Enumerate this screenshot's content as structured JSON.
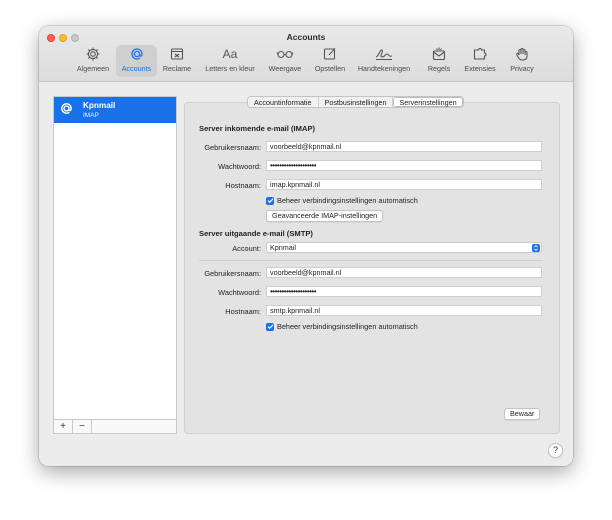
{
  "window": {
    "title": "Accounts"
  },
  "toolbar": {
    "tabs": [
      {
        "label": "Algemeen",
        "icon": "gear-icon"
      },
      {
        "label": "Accounts",
        "icon": "at-icon",
        "active": true
      },
      {
        "label": "Reclame",
        "icon": "junk-mail-icon"
      },
      {
        "label": "Letters en kleur",
        "icon": "font-icon"
      },
      {
        "label": "Weergave",
        "icon": "glasses-icon"
      },
      {
        "label": "Opstellen",
        "icon": "compose-icon"
      },
      {
        "label": "Handtekeningen",
        "icon": "signature-icon"
      },
      {
        "label": "Regels",
        "icon": "rules-icon"
      },
      {
        "label": "Extensies",
        "icon": "extensions-icon"
      },
      {
        "label": "Privacy",
        "icon": "hand-icon"
      }
    ],
    "font_glyph": "Aa"
  },
  "sidebar": {
    "account": {
      "name": "Kpnmail",
      "type": "IMAP"
    },
    "add_label": "+",
    "remove_label": "−"
  },
  "segments": [
    "Accountinformatie",
    "Postbusinstellingen",
    "Serverinstellingen"
  ],
  "selected_segment": "Serverinstellingen",
  "incoming": {
    "heading": "Server inkomende e-mail (IMAP)",
    "username_label": "Gebruikersnaam:",
    "username": "voorbeeld@kpnmail.nl",
    "password_label": "Wachtwoord:",
    "password_mask": "••••••••••••••••••••",
    "host_label": "Hostnaam:",
    "host": "imap.kpnmail.nl",
    "auto_label": "Beheer verbindingsinstellingen automatisch",
    "advanced_button": "Geavanceerde IMAP-instellingen"
  },
  "outgoing": {
    "heading": "Server uitgaande e-mail (SMTP)",
    "account_label": "Account:",
    "account_value": "Kpnmail",
    "username_label": "Gebruikersnaam:",
    "username": "voorbeeld@kpnmail.nl",
    "password_label": "Wachtwoord:",
    "password_mask": "••••••••••••••••••••",
    "host_label": "Hostnaam:",
    "host": "smtp.kpnmail.nl",
    "auto_label": "Beheer verbindingsinstellingen automatisch"
  },
  "save_button": "Bewaar",
  "help_label": "?",
  "colors": {
    "accent": "#1a72e8",
    "close": "#ff5f57",
    "minimize": "#febc2e"
  }
}
